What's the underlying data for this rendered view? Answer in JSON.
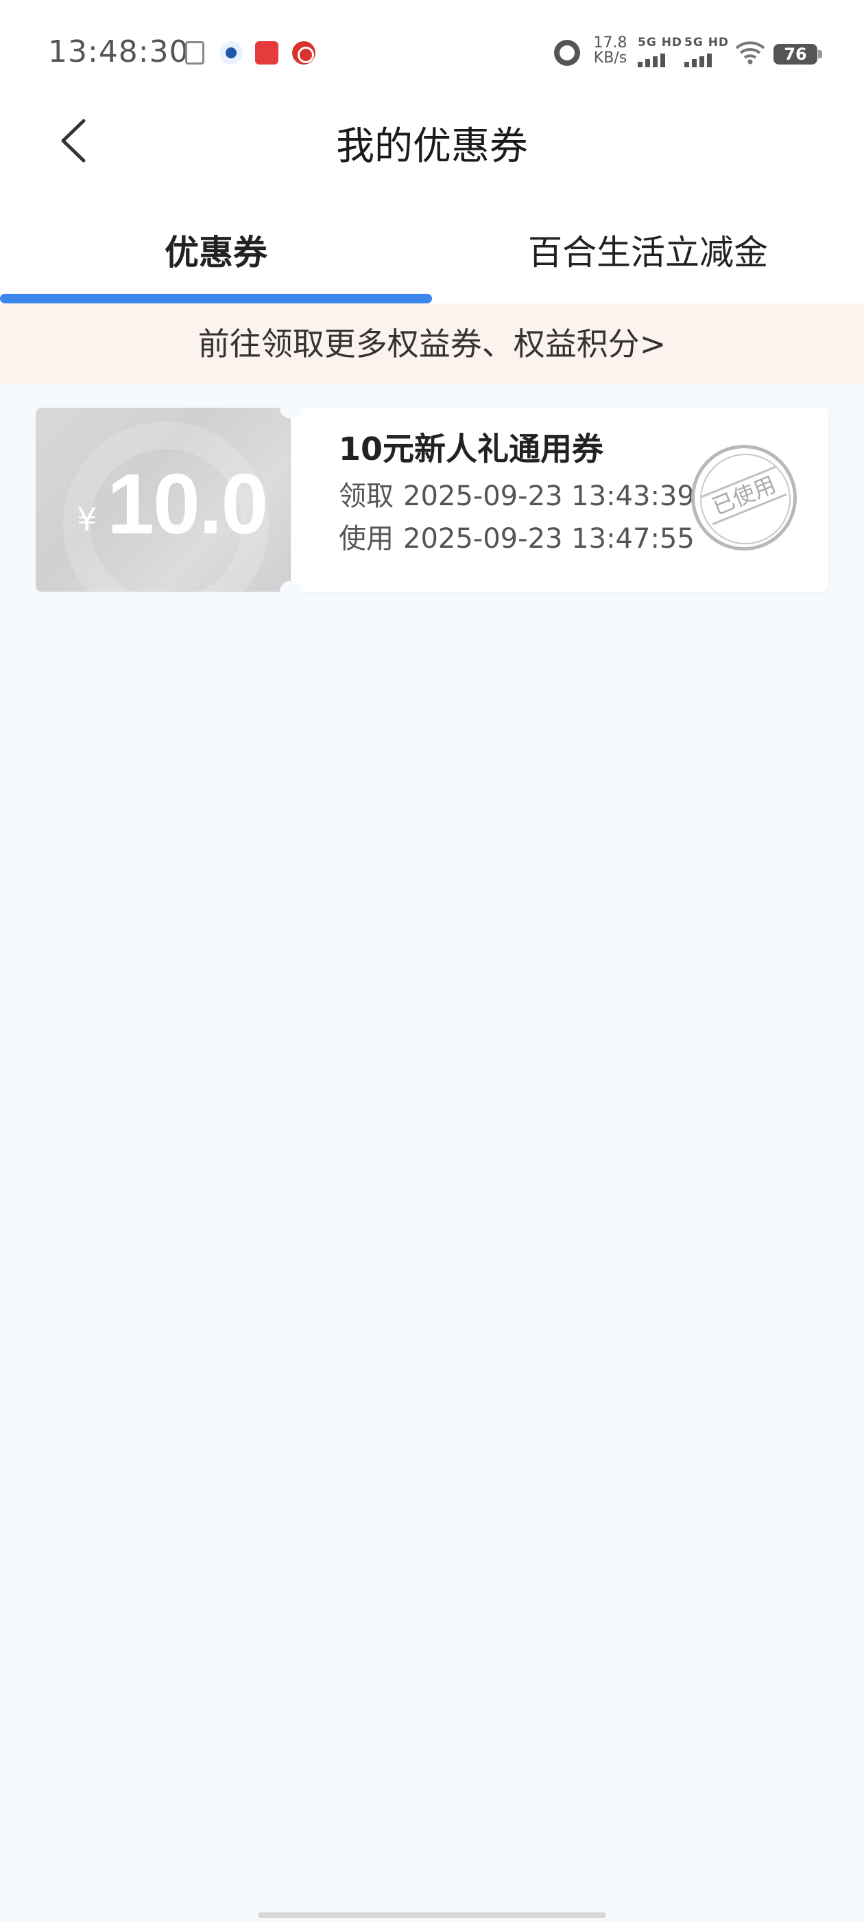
{
  "status_bar": {
    "time": "13:48:30",
    "net_speed_value": "17.8",
    "net_speed_unit": "KB/s",
    "signal1_label": "5G HD",
    "signal2_label": "5G HD",
    "battery": "76"
  },
  "header": {
    "title": "我的优惠券",
    "back_icon": "chevron-left-icon"
  },
  "tabs": [
    {
      "label": "优惠券",
      "active": true
    },
    {
      "label": "百合生活立减金",
      "active": false
    }
  ],
  "promo": {
    "text": "前往领取更多权益券、权益积分>"
  },
  "coupons": [
    {
      "currency": "¥",
      "amount": "10.0",
      "name": "10元新人礼通用券",
      "claim_label": "领取",
      "claim_time": "2025-09-23 13:43:39",
      "use_label": "使用",
      "use_time": "2025-09-23 13:47:55",
      "stamp": "已使用"
    }
  ],
  "colors": {
    "accent": "#3d86ee",
    "page_bg": "#f6f9fd",
    "promo_bg": "#fdf3ee",
    "stub_gray": "#d3d3d3"
  }
}
